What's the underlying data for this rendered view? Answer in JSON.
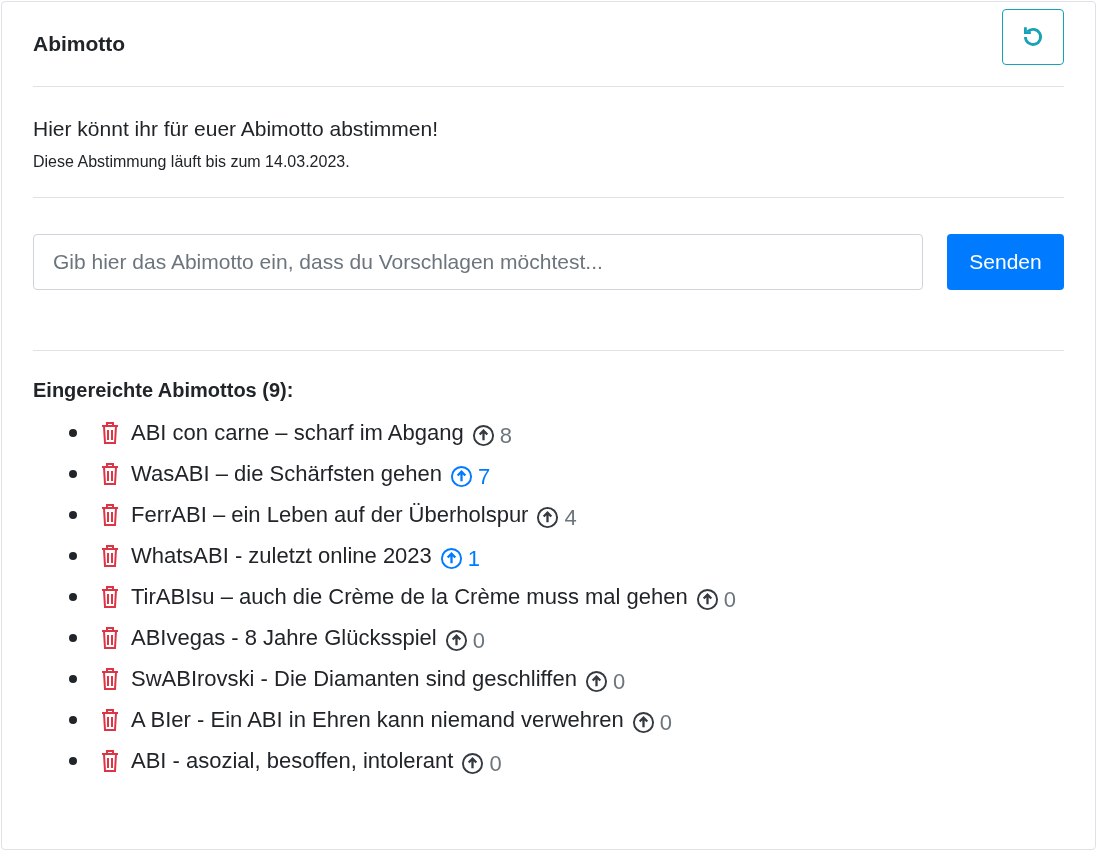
{
  "card": {
    "title": "Abimotto"
  },
  "intro": {
    "headline": "Hier könnt ihr für euer Abimotto abstimmen!",
    "deadline": "Diese Abstimmung läuft bis zum 14.03.2023."
  },
  "form": {
    "placeholder": "Gib hier das Abimotto ein, dass du Vorschlagen möchtest...",
    "submit": "Senden"
  },
  "list": {
    "heading": "Eingereichte Abimottos (9):",
    "items": [
      {
        "text": "ABI con carne – scharf im Abgang",
        "votes": "8",
        "voted": false
      },
      {
        "text": "WasABI – die Schärfsten gehen",
        "votes": "7",
        "voted": true
      },
      {
        "text": "FerrABI – ein Leben auf der Überholspur",
        "votes": "4",
        "voted": false
      },
      {
        "text": "WhatsABI - zuletzt online 2023",
        "votes": "1",
        "voted": true
      },
      {
        "text": "TirABIsu – auch die Crème de la Crème muss mal gehen",
        "votes": "0",
        "voted": false
      },
      {
        "text": "ABIvegas - 8 Jahre Glücksspiel",
        "votes": "0",
        "voted": false
      },
      {
        "text": "SwABIrovski - Die Diamanten sind geschliffen",
        "votes": "0",
        "voted": false
      },
      {
        "text": "A BIer - Ein ABI in Ehren kann niemand verwehren",
        "votes": "0",
        "voted": false
      },
      {
        "text": "ABI - asozial, besoffen, intolerant",
        "votes": "0",
        "voted": false
      }
    ]
  }
}
